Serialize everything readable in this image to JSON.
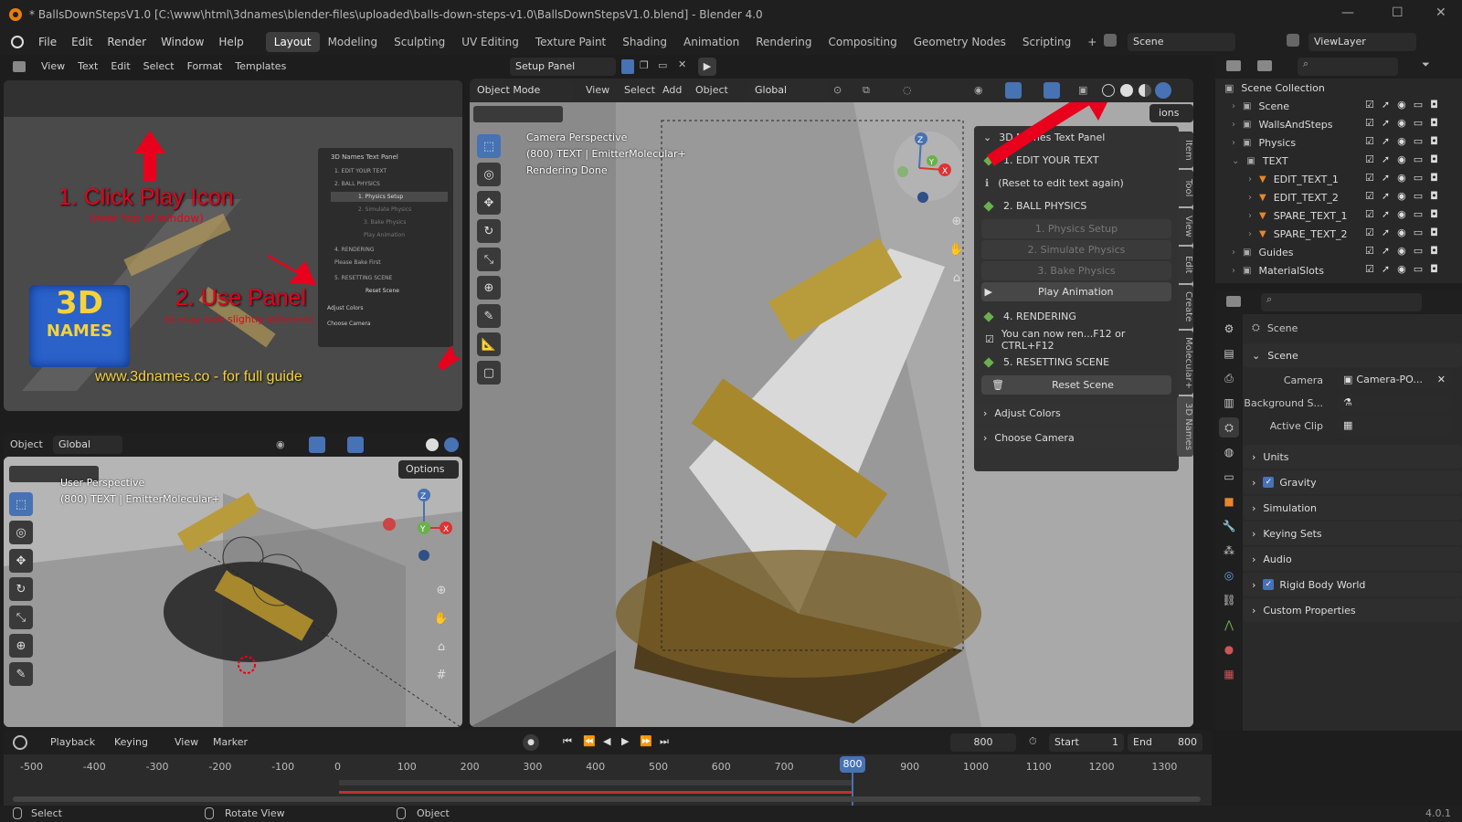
{
  "titlebar": {
    "title": "* BallsDownStepsV1.0 [C:\\www\\html\\3dnames\\blender-files\\uploaded\\balls-down-steps-v1.0\\BallsDownStepsV1.0.blend] - Blender 4.0"
  },
  "menu": {
    "items": [
      "File",
      "Edit",
      "Render",
      "Window",
      "Help"
    ],
    "workspaces": [
      "Layout",
      "Modeling",
      "Sculpting",
      "UV Editing",
      "Texture Paint",
      "Shading",
      "Animation",
      "Rendering",
      "Compositing",
      "Geometry Nodes",
      "Scripting"
    ],
    "scene": "Scene",
    "viewlayer": "ViewLayer",
    "add": "+"
  },
  "text_editor": {
    "menu": [
      "View",
      "Text",
      "Edit",
      "Select",
      "Format",
      "Templates"
    ],
    "file": "Setup Panel"
  },
  "tutorial": {
    "step1": "1. Click Play Icon",
    "step1_sub": "(near top of window)",
    "step2": "2. Use Panel",
    "step2_sub": "(it may look slightly different)",
    "footer": "www.3dnames.co - for full guide",
    "logo_line1": "3D",
    "logo_line2": "NAMES",
    "mini_items": [
      "3D Names Text Panel",
      "1. EDIT YOUR TEXT",
      "2. BALL PHYSICS",
      "1. Physics Setup",
      "2. Simulate Physics",
      "3. Bake Physics",
      "Play Animation",
      "4. RENDERING",
      "Please Bake First",
      "5. RESETTING SCENE",
      "Reset Scene",
      "Adjust Colors",
      "Choose Camera"
    ]
  },
  "viewport_small": {
    "mode": "Object",
    "orient": "Global",
    "options": "Options",
    "line1": "User Perspective",
    "line2": "(800) TEXT | EmitterMolecular+"
  },
  "viewport_main": {
    "mode": "Object Mode",
    "menu": [
      "View",
      "Select",
      "Add",
      "Object"
    ],
    "orient": "Global",
    "line1": "Camera Perspective",
    "line2": "(800) TEXT | EmitterMolecular+",
    "line3": "Rendering Done",
    "options": "ions",
    "tabs": [
      "Item",
      "Tool",
      "View",
      "Edit",
      "Create",
      "Molecular+",
      "3D Names"
    ],
    "gizmo": {
      "z": "Z",
      "y": "Y",
      "x": "X"
    }
  },
  "npanel": {
    "title": "3D Names Text Panel",
    "edit": "1. EDIT YOUR TEXT",
    "reset_note": "(Reset to edit text again)",
    "ball": "2. BALL PHYSICS",
    "btn1": "1. Physics Setup",
    "btn2": "2. Simulate Physics",
    "btn3": "3. Bake Physics",
    "play": "Play Animation",
    "render": "4. RENDERING",
    "render_note": "You can now ren...F12 or CTRL+F12",
    "resetting": "5. RESETTING SCENE",
    "reset": "Reset Scene",
    "colors": "Adjust Colors",
    "camera": "Choose Camera"
  },
  "outliner": {
    "root": "Scene Collection",
    "rows": [
      {
        "label": "Scene",
        "indent": 0
      },
      {
        "label": "WallsAndSteps",
        "indent": 0
      },
      {
        "label": "Physics",
        "indent": 0
      },
      {
        "label": "TEXT",
        "indent": 0
      },
      {
        "label": "EDIT_TEXT_1",
        "indent": 1
      },
      {
        "label": "EDIT_TEXT_2",
        "indent": 1
      },
      {
        "label": "SPARE_TEXT_1",
        "indent": 1
      },
      {
        "label": "SPARE_TEXT_2",
        "indent": 1
      },
      {
        "label": "Guides",
        "indent": 0
      },
      {
        "label": "MaterialSlots",
        "indent": 0
      }
    ]
  },
  "properties": {
    "crumb": "Scene",
    "section": "Scene",
    "camera_label": "Camera",
    "camera_value": "Camera-PO...",
    "bg_label": "Background S...",
    "clip_label": "Active Clip",
    "panels": [
      "Units",
      "Gravity",
      "Simulation",
      "Keying Sets",
      "Audio",
      "Rigid Body World",
      "Custom Properties"
    ]
  },
  "timeline": {
    "menu": [
      "Playback",
      "Keying",
      "View",
      "Marker"
    ],
    "frame": "800",
    "start_label": "Start",
    "start": "1",
    "end_label": "End",
    "end": "800",
    "current": "800",
    "ticks": [
      "-500",
      "-400",
      "-300",
      "-200",
      "-100",
      "0",
      "100",
      "200",
      "300",
      "400",
      "500",
      "600",
      "700",
      "900",
      "1000",
      "1100",
      "1200",
      "1300"
    ]
  },
  "status": {
    "select": "Select",
    "rotate": "Rotate View",
    "object": "Object",
    "version": "4.0.1"
  },
  "colors": {
    "accent": "#4772b3",
    "orange": "#e87d0d",
    "red": "#e8001c"
  }
}
